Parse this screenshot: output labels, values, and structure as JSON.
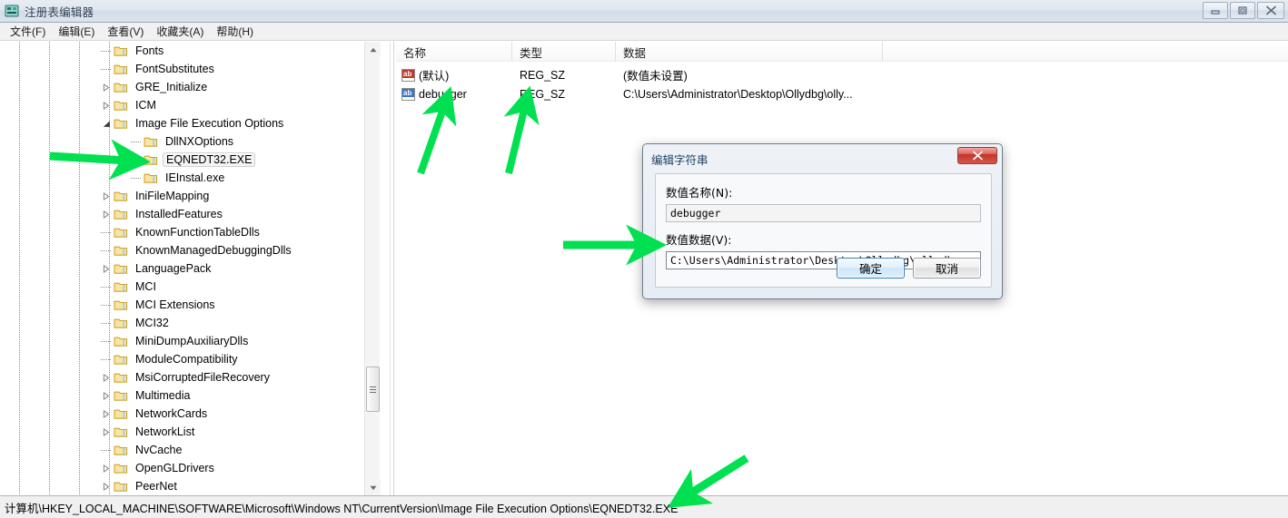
{
  "window": {
    "title": "注册表编辑器",
    "app_icon": "registry-editor-icon",
    "minimize_label": "最小化",
    "maximize_label": "最大化",
    "close_label": "关闭"
  },
  "menu": {
    "items": [
      {
        "label": "文件(F)",
        "name": "menu-file"
      },
      {
        "label": "编辑(E)",
        "name": "menu-edit"
      },
      {
        "label": "查看(V)",
        "name": "menu-view"
      },
      {
        "label": "收藏夹(A)",
        "name": "menu-favorites"
      },
      {
        "label": "帮助(H)",
        "name": "menu-help"
      }
    ]
  },
  "tree": {
    "items": [
      {
        "label": "Fonts",
        "depth": 4,
        "twisty": "none",
        "selected": false
      },
      {
        "label": "FontSubstitutes",
        "depth": 4,
        "twisty": "none",
        "selected": false
      },
      {
        "label": "GRE_Initialize",
        "depth": 4,
        "twisty": "collapsed",
        "selected": false
      },
      {
        "label": "ICM",
        "depth": 4,
        "twisty": "collapsed",
        "selected": false
      },
      {
        "label": "Image File Execution Options",
        "depth": 4,
        "twisty": "expanded",
        "selected": false
      },
      {
        "label": "DllNXOptions",
        "depth": 5,
        "twisty": "none",
        "selected": false
      },
      {
        "label": "EQNEDT32.EXE",
        "depth": 5,
        "twisty": "none",
        "selected": true
      },
      {
        "label": "IEInstal.exe",
        "depth": 5,
        "twisty": "none",
        "selected": false
      },
      {
        "label": "IniFileMapping",
        "depth": 4,
        "twisty": "collapsed",
        "selected": false
      },
      {
        "label": "InstalledFeatures",
        "depth": 4,
        "twisty": "collapsed",
        "selected": false
      },
      {
        "label": "KnownFunctionTableDlls",
        "depth": 4,
        "twisty": "none",
        "selected": false
      },
      {
        "label": "KnownManagedDebuggingDlls",
        "depth": 4,
        "twisty": "none",
        "selected": false
      },
      {
        "label": "LanguagePack",
        "depth": 4,
        "twisty": "collapsed",
        "selected": false
      },
      {
        "label": "MCI",
        "depth": 4,
        "twisty": "none",
        "selected": false
      },
      {
        "label": "MCI Extensions",
        "depth": 4,
        "twisty": "none",
        "selected": false
      },
      {
        "label": "MCI32",
        "depth": 4,
        "twisty": "none",
        "selected": false
      },
      {
        "label": "MiniDumpAuxiliaryDlls",
        "depth": 4,
        "twisty": "none",
        "selected": false
      },
      {
        "label": "ModuleCompatibility",
        "depth": 4,
        "twisty": "none",
        "selected": false
      },
      {
        "label": "MsiCorruptedFileRecovery",
        "depth": 4,
        "twisty": "collapsed",
        "selected": false
      },
      {
        "label": "Multimedia",
        "depth": 4,
        "twisty": "collapsed",
        "selected": false
      },
      {
        "label": "NetworkCards",
        "depth": 4,
        "twisty": "collapsed",
        "selected": false
      },
      {
        "label": "NetworkList",
        "depth": 4,
        "twisty": "collapsed",
        "selected": false
      },
      {
        "label": "NvCache",
        "depth": 4,
        "twisty": "none",
        "selected": false
      },
      {
        "label": "OpenGLDrivers",
        "depth": 4,
        "twisty": "collapsed",
        "selected": false
      },
      {
        "label": "PeerNet",
        "depth": 4,
        "twisty": "collapsed",
        "selected": false
      }
    ],
    "scrollbar": {
      "up_arrow": "▲",
      "down_arrow": "▼"
    }
  },
  "list": {
    "columns": [
      {
        "label": "名称",
        "name": "column-name"
      },
      {
        "label": "类型",
        "name": "column-type"
      },
      {
        "label": "数据",
        "name": "column-data"
      }
    ],
    "rows": [
      {
        "icon": "ab-string-icon-red",
        "name": "(默认)",
        "type": "REG_SZ",
        "data": "(数值未设置)"
      },
      {
        "icon": "ab-string-icon-blue",
        "name": "debugger",
        "type": "REG_SZ",
        "data": "C:\\Users\\Administrator\\Desktop\\Ollydbg\\olly..."
      }
    ]
  },
  "status_bar": {
    "path": "计算机\\HKEY_LOCAL_MACHINE\\SOFTWARE\\Microsoft\\Windows NT\\CurrentVersion\\Image File Execution Options\\EQNEDT32.EXE"
  },
  "dialog": {
    "title": "编辑字符串",
    "close_label": "✕",
    "value_name_label": "数值名称(N):",
    "value_name": "debugger",
    "value_data_label": "数值数据(V):",
    "value_data": "C:\\Users\\Administrator\\Desktop\\Ollydbg\\ollydbg.exe",
    "ok_label": "确定",
    "cancel_label": "取消"
  },
  "annotations": {
    "color": "#00E050",
    "arrows": [
      {
        "name": "arrow-to-eqnedt32-node",
        "desc": "points right at EQNEDT32.EXE tree node"
      },
      {
        "name": "arrow-to-value-name-column",
        "desc": "points up at the debugger value name"
      },
      {
        "name": "arrow-to-value-type-column",
        "desc": "points up at the REG_SZ type"
      },
      {
        "name": "arrow-to-value-data-input",
        "desc": "points right at the dialog value data field"
      },
      {
        "name": "arrow-to-status-bar-path",
        "desc": "points down-left at the registry path in status bar"
      }
    ]
  }
}
